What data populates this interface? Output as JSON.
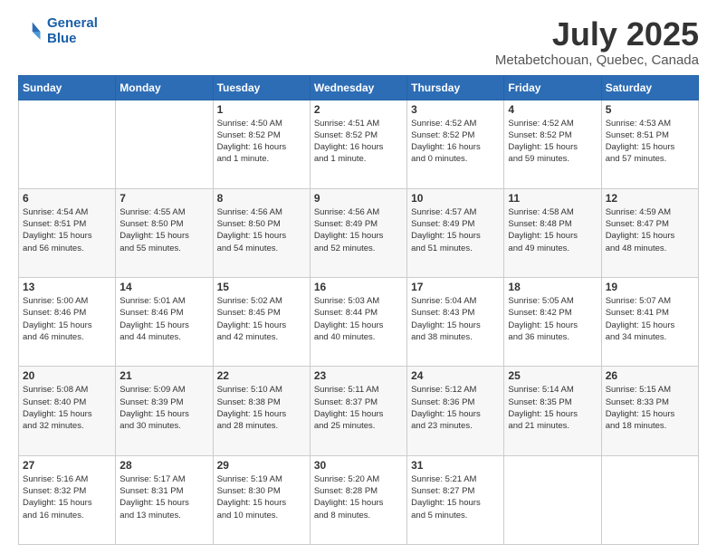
{
  "header": {
    "logo_line1": "General",
    "logo_line2": "Blue",
    "title": "July 2025",
    "subtitle": "Metabetchouan, Quebec, Canada"
  },
  "weekdays": [
    "Sunday",
    "Monday",
    "Tuesday",
    "Wednesday",
    "Thursday",
    "Friday",
    "Saturday"
  ],
  "weeks": [
    [
      {
        "day": "",
        "info": ""
      },
      {
        "day": "",
        "info": ""
      },
      {
        "day": "1",
        "info": "Sunrise: 4:50 AM\nSunset: 8:52 PM\nDaylight: 16 hours\nand 1 minute."
      },
      {
        "day": "2",
        "info": "Sunrise: 4:51 AM\nSunset: 8:52 PM\nDaylight: 16 hours\nand 1 minute."
      },
      {
        "day": "3",
        "info": "Sunrise: 4:52 AM\nSunset: 8:52 PM\nDaylight: 16 hours\nand 0 minutes."
      },
      {
        "day": "4",
        "info": "Sunrise: 4:52 AM\nSunset: 8:52 PM\nDaylight: 15 hours\nand 59 minutes."
      },
      {
        "day": "5",
        "info": "Sunrise: 4:53 AM\nSunset: 8:51 PM\nDaylight: 15 hours\nand 57 minutes."
      }
    ],
    [
      {
        "day": "6",
        "info": "Sunrise: 4:54 AM\nSunset: 8:51 PM\nDaylight: 15 hours\nand 56 minutes."
      },
      {
        "day": "7",
        "info": "Sunrise: 4:55 AM\nSunset: 8:50 PM\nDaylight: 15 hours\nand 55 minutes."
      },
      {
        "day": "8",
        "info": "Sunrise: 4:56 AM\nSunset: 8:50 PM\nDaylight: 15 hours\nand 54 minutes."
      },
      {
        "day": "9",
        "info": "Sunrise: 4:56 AM\nSunset: 8:49 PM\nDaylight: 15 hours\nand 52 minutes."
      },
      {
        "day": "10",
        "info": "Sunrise: 4:57 AM\nSunset: 8:49 PM\nDaylight: 15 hours\nand 51 minutes."
      },
      {
        "day": "11",
        "info": "Sunrise: 4:58 AM\nSunset: 8:48 PM\nDaylight: 15 hours\nand 49 minutes."
      },
      {
        "day": "12",
        "info": "Sunrise: 4:59 AM\nSunset: 8:47 PM\nDaylight: 15 hours\nand 48 minutes."
      }
    ],
    [
      {
        "day": "13",
        "info": "Sunrise: 5:00 AM\nSunset: 8:46 PM\nDaylight: 15 hours\nand 46 minutes."
      },
      {
        "day": "14",
        "info": "Sunrise: 5:01 AM\nSunset: 8:46 PM\nDaylight: 15 hours\nand 44 minutes."
      },
      {
        "day": "15",
        "info": "Sunrise: 5:02 AM\nSunset: 8:45 PM\nDaylight: 15 hours\nand 42 minutes."
      },
      {
        "day": "16",
        "info": "Sunrise: 5:03 AM\nSunset: 8:44 PM\nDaylight: 15 hours\nand 40 minutes."
      },
      {
        "day": "17",
        "info": "Sunrise: 5:04 AM\nSunset: 8:43 PM\nDaylight: 15 hours\nand 38 minutes."
      },
      {
        "day": "18",
        "info": "Sunrise: 5:05 AM\nSunset: 8:42 PM\nDaylight: 15 hours\nand 36 minutes."
      },
      {
        "day": "19",
        "info": "Sunrise: 5:07 AM\nSunset: 8:41 PM\nDaylight: 15 hours\nand 34 minutes."
      }
    ],
    [
      {
        "day": "20",
        "info": "Sunrise: 5:08 AM\nSunset: 8:40 PM\nDaylight: 15 hours\nand 32 minutes."
      },
      {
        "day": "21",
        "info": "Sunrise: 5:09 AM\nSunset: 8:39 PM\nDaylight: 15 hours\nand 30 minutes."
      },
      {
        "day": "22",
        "info": "Sunrise: 5:10 AM\nSunset: 8:38 PM\nDaylight: 15 hours\nand 28 minutes."
      },
      {
        "day": "23",
        "info": "Sunrise: 5:11 AM\nSunset: 8:37 PM\nDaylight: 15 hours\nand 25 minutes."
      },
      {
        "day": "24",
        "info": "Sunrise: 5:12 AM\nSunset: 8:36 PM\nDaylight: 15 hours\nand 23 minutes."
      },
      {
        "day": "25",
        "info": "Sunrise: 5:14 AM\nSunset: 8:35 PM\nDaylight: 15 hours\nand 21 minutes."
      },
      {
        "day": "26",
        "info": "Sunrise: 5:15 AM\nSunset: 8:33 PM\nDaylight: 15 hours\nand 18 minutes."
      }
    ],
    [
      {
        "day": "27",
        "info": "Sunrise: 5:16 AM\nSunset: 8:32 PM\nDaylight: 15 hours\nand 16 minutes."
      },
      {
        "day": "28",
        "info": "Sunrise: 5:17 AM\nSunset: 8:31 PM\nDaylight: 15 hours\nand 13 minutes."
      },
      {
        "day": "29",
        "info": "Sunrise: 5:19 AM\nSunset: 8:30 PM\nDaylight: 15 hours\nand 10 minutes."
      },
      {
        "day": "30",
        "info": "Sunrise: 5:20 AM\nSunset: 8:28 PM\nDaylight: 15 hours\nand 8 minutes."
      },
      {
        "day": "31",
        "info": "Sunrise: 5:21 AM\nSunset: 8:27 PM\nDaylight: 15 hours\nand 5 minutes."
      },
      {
        "day": "",
        "info": ""
      },
      {
        "day": "",
        "info": ""
      }
    ]
  ]
}
